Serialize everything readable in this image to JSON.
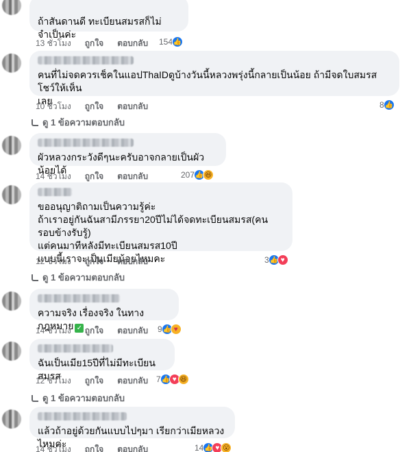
{
  "comments": [
    {
      "text": "ถ้าสันดานดี ทะเบียนสมรสก็ไม่จำเป็นค่ะ",
      "time": "13 ชั่วโมง",
      "like": "ถูกใจ",
      "reply": "ตอบกลับ",
      "count": "154",
      "reactions": [
        "like-icon"
      ]
    },
    {
      "text": "คนที่ไม่จดควรเช็คในแอปThaIDดูบ้างวันนี้หลวงพรุ่งนี้กลายเป็นน้อย ถ้ามีจดใบสมรสโชว์ให้เห็น\nเลย",
      "time": "10 ชั่วโมง",
      "like": "ถูกใจ",
      "reply": "ตอบกลับ",
      "count": "8",
      "reactions": [
        "like-icon"
      ],
      "replies": "ดู 1 ข้อความตอบกลับ"
    },
    {
      "text": "ผัวหลวงกระวังดีๆนะครับอาจกลายเป็นผัวน้อยได้",
      "time": "14 ชั่วโมง",
      "like": "ถูกใจ",
      "reply": "ตอบกลับ",
      "count": "207",
      "reactions": [
        "like-icon",
        "haha-icon"
      ]
    },
    {
      "text": "ขออนุญาติถามเป็นความรู้ค่ะ\nถ้าเราอยู่กันฉันสามีภรรยา20ปีไม่ได้จดทะเบียนสมรส(คนรอบข้างรับรู้)\nแต่คนมาทีหลังมีทะเบียนสมรส10ปี\nแบบนี้เราจะเป็นเมียน้อยไหมคะ",
      "time": "12 ชั่วโมง",
      "like": "ถูกใจ",
      "reply": "ตอบกลับ",
      "count": "3",
      "reactions": [
        "like-icon",
        "love-icon"
      ],
      "replies": "ดู 1 ข้อความตอบกลับ"
    },
    {
      "text": "ความจริง เรื่องจริง ในทางกฎหมาย",
      "time": "14 ชั่วโมง",
      "like": "ถูกใจ",
      "reply": "ตอบกลับ",
      "count": "9",
      "reactions": [
        "like-icon",
        "care-icon"
      ],
      "emoji": "check-mark-icon"
    },
    {
      "text": "ฉันเป็นเมีย15ปีที่ไม่มีทะเบียนสมรส",
      "time": "12 ชั่วโมง",
      "like": "ถูกใจ",
      "reply": "ตอบกลับ",
      "count": "7",
      "reactions": [
        "like-icon",
        "love-icon",
        "haha-icon"
      ],
      "replies": "ดู 1 ข้อความตอบกลับ"
    },
    {
      "text": "แล้วถ้าอยู่ด้วยกันแบบไปๆมา เรียกว่าเมียหลวงไหมค่ะ",
      "time": "14 ชั่วโมง",
      "like": "ถูกใจ",
      "reply": "ตอบกลับ",
      "count": "14",
      "reactions": [
        "like-icon",
        "love-icon",
        "wow-icon"
      ]
    }
  ],
  "colors": {
    "like": "#1877f2",
    "love": "#f33e58",
    "haha": "#f7b125",
    "bubble": "#f0f2f5",
    "meta": "#65676b"
  }
}
